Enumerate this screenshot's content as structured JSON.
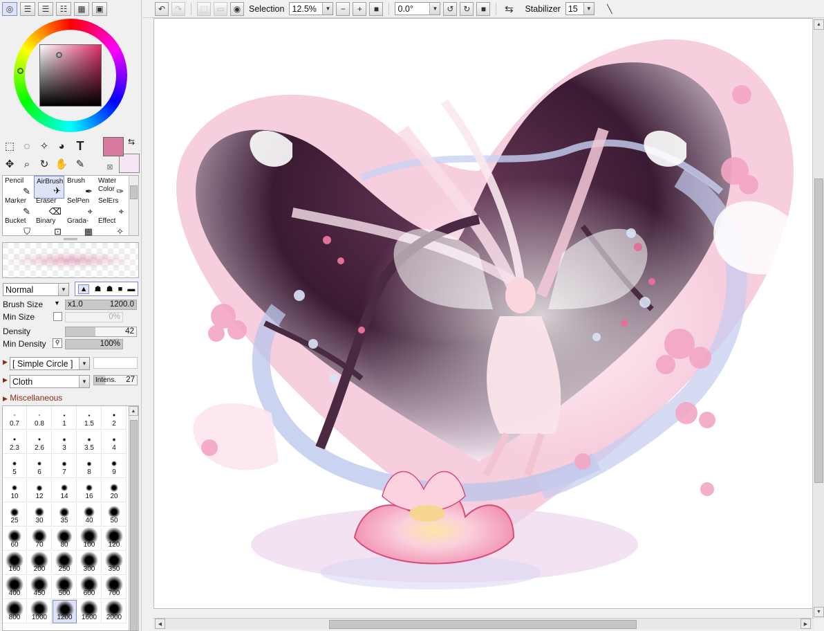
{
  "toolbar": {
    "selection_label": "Selection",
    "zoom": "12.5%",
    "rotation": "0.0°",
    "stabilizer_label": "Stabilizer",
    "stabilizer_value": "15"
  },
  "color": {
    "main": "#d87aa0",
    "sub": "#f6e6f6"
  },
  "brushes": [
    {
      "label": "Pencil"
    },
    {
      "label": "AirBrush"
    },
    {
      "label": "Brush"
    },
    {
      "label": "Water Color"
    },
    {
      "label": "Marker"
    },
    {
      "label": "Eraser"
    },
    {
      "label": "SelPen"
    },
    {
      "label": "SelErs"
    },
    {
      "label": "Bucket"
    },
    {
      "label": "Binary"
    },
    {
      "label": "Grada-"
    },
    {
      "label": "Effect"
    }
  ],
  "blend_mode": "Normal",
  "brush_size": {
    "label": "Brush Size",
    "mult": "x1.0",
    "value": "1200.0"
  },
  "min_size": {
    "label": "Min Size",
    "value": "0%"
  },
  "density": {
    "label": "Density",
    "value": "42"
  },
  "min_density": {
    "label": "Min Density",
    "value": "100%"
  },
  "shape": "[ Simple Circle ]",
  "texture": "Cloth",
  "texture_intens_label": "Intens.",
  "texture_intens": "27",
  "misc_label": "Miscellaneous",
  "brush_sizes": [
    "0.7",
    "0.8",
    "1",
    "1.5",
    "2",
    "2.3",
    "2.6",
    "3",
    "3.5",
    "4",
    "5",
    "6",
    "7",
    "8",
    "9",
    "10",
    "12",
    "14",
    "16",
    "20",
    "25",
    "30",
    "35",
    "40",
    "50",
    "60",
    "70",
    "80",
    "100",
    "120",
    "160",
    "200",
    "250",
    "300",
    "350",
    "400",
    "450",
    "500",
    "600",
    "700",
    "800",
    "1000",
    "1200",
    "1600",
    "2000"
  ],
  "selected_size": "1200"
}
